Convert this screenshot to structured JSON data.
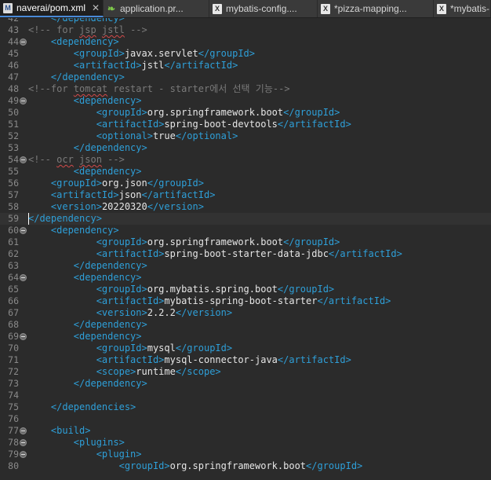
{
  "tabs": [
    {
      "label": "naverai/pom.xml",
      "icon": "maven-m-icon",
      "icon_glyph": "M",
      "active": true,
      "close": "✕"
    },
    {
      "label": "application.pr...",
      "icon": "spring-leaf-icon",
      "icon_glyph": "❧",
      "active": false
    },
    {
      "label": "mybatis-config....",
      "icon": "xml-file-icon",
      "icon_glyph": "X",
      "active": false
    },
    {
      "label": "*pizza-mapping...",
      "icon": "xml-file-icon",
      "icon_glyph": "X",
      "active": false
    },
    {
      "label": "*mybatis-",
      "icon": "xml-file-icon",
      "icon_glyph": "X",
      "active": false
    }
  ],
  "lines": [
    {
      "n": "42",
      "parts": [
        [
          "    ",
          "tx"
        ],
        [
          "</dependency>",
          "tg"
        ]
      ]
    },
    {
      "n": "43",
      "parts": [
        [
          "<!-- for ",
          "cm"
        ],
        [
          "jsp",
          "cm sq"
        ],
        [
          " ",
          "cm"
        ],
        [
          "jstl",
          "cm sq"
        ],
        [
          " -->",
          "cm"
        ]
      ]
    },
    {
      "n": "44",
      "fold": true,
      "parts": [
        [
          "    ",
          "tx"
        ],
        [
          "<dependency>",
          "tg"
        ]
      ]
    },
    {
      "n": "45",
      "parts": [
        [
          "        ",
          "tx"
        ],
        [
          "<groupId>",
          "tg"
        ],
        [
          "javax.servlet",
          "tx"
        ],
        [
          "</groupId>",
          "tg"
        ]
      ]
    },
    {
      "n": "46",
      "parts": [
        [
          "        ",
          "tx"
        ],
        [
          "<artifactId>",
          "tg"
        ],
        [
          "jstl",
          "tx"
        ],
        [
          "</artifactId>",
          "tg"
        ]
      ]
    },
    {
      "n": "47",
      "parts": [
        [
          "    ",
          "tx"
        ],
        [
          "</dependency>",
          "tg"
        ]
      ]
    },
    {
      "n": "48",
      "parts": [
        [
          "<!--for ",
          "cm"
        ],
        [
          "tomcat",
          "cm sq"
        ],
        [
          " restart - starter에서 선택 기능-->",
          "cm"
        ]
      ]
    },
    {
      "n": "49",
      "fold": true,
      "parts": [
        [
          "        ",
          "tx"
        ],
        [
          "<dependency>",
          "tg"
        ]
      ]
    },
    {
      "n": "50",
      "parts": [
        [
          "            ",
          "tx"
        ],
        [
          "<groupId>",
          "tg"
        ],
        [
          "org.springframework.boot",
          "tx"
        ],
        [
          "</groupId>",
          "tg"
        ]
      ]
    },
    {
      "n": "51",
      "parts": [
        [
          "            ",
          "tx"
        ],
        [
          "<artifactId>",
          "tg"
        ],
        [
          "spring-boot-devtools",
          "tx"
        ],
        [
          "</artifactId>",
          "tg"
        ]
      ]
    },
    {
      "n": "52",
      "parts": [
        [
          "            ",
          "tx"
        ],
        [
          "<optional>",
          "tg"
        ],
        [
          "true",
          "tx"
        ],
        [
          "</optional>",
          "tg"
        ]
      ]
    },
    {
      "n": "53",
      "parts": [
        [
          "        ",
          "tx"
        ],
        [
          "</dependency>",
          "tg"
        ]
      ]
    },
    {
      "n": "54",
      "fold": true,
      "parts": [
        [
          "<!-- ",
          "cm"
        ],
        [
          "ocr",
          "cm sq"
        ],
        [
          " ",
          "cm"
        ],
        [
          "json",
          "cm sq"
        ],
        [
          " -->",
          "cm"
        ]
      ]
    },
    {
      "n": "55",
      "parts": [
        [
          "        ",
          "tx"
        ],
        [
          "<dependency>",
          "tg"
        ]
      ]
    },
    {
      "n": "56",
      "parts": [
        [
          "    ",
          "tx"
        ],
        [
          "<groupId>",
          "tg"
        ],
        [
          "org.json",
          "tx"
        ],
        [
          "</groupId>",
          "tg"
        ]
      ]
    },
    {
      "n": "57",
      "parts": [
        [
          "    ",
          "tx"
        ],
        [
          "<artifactId>",
          "tg"
        ],
        [
          "json",
          "tx"
        ],
        [
          "</artifactId>",
          "tg"
        ]
      ]
    },
    {
      "n": "58",
      "parts": [
        [
          "    ",
          "tx"
        ],
        [
          "<version>",
          "tg"
        ],
        [
          "20220320",
          "tx"
        ],
        [
          "</version>",
          "tg"
        ]
      ]
    },
    {
      "n": "59",
      "current": true,
      "caret": true,
      "parts": [
        [
          "</dependency>",
          "tg"
        ]
      ]
    },
    {
      "n": "60",
      "fold": true,
      "parts": [
        [
          "    ",
          "tx"
        ],
        [
          "<dependency>",
          "tg"
        ]
      ]
    },
    {
      "n": "61",
      "parts": [
        [
          "            ",
          "tx"
        ],
        [
          "<groupId>",
          "tg"
        ],
        [
          "org.springframework.boot",
          "tx"
        ],
        [
          "</groupId>",
          "tg"
        ]
      ]
    },
    {
      "n": "62",
      "parts": [
        [
          "            ",
          "tx"
        ],
        [
          "<artifactId>",
          "tg"
        ],
        [
          "spring-boot-starter-data-jdbc",
          "tx"
        ],
        [
          "</artifactId>",
          "tg"
        ]
      ]
    },
    {
      "n": "63",
      "parts": [
        [
          "        ",
          "tx"
        ],
        [
          "</dependency>",
          "tg"
        ]
      ]
    },
    {
      "n": "64",
      "fold": true,
      "parts": [
        [
          "        ",
          "tx"
        ],
        [
          "<dependency>",
          "tg"
        ]
      ]
    },
    {
      "n": "65",
      "parts": [
        [
          "            ",
          "tx"
        ],
        [
          "<groupId>",
          "tg"
        ],
        [
          "org.mybatis.spring.boot",
          "tx"
        ],
        [
          "</groupId>",
          "tg"
        ]
      ]
    },
    {
      "n": "66",
      "parts": [
        [
          "            ",
          "tx"
        ],
        [
          "<artifactId>",
          "tg"
        ],
        [
          "mybatis-spring-boot-starter",
          "tx"
        ],
        [
          "</artifactId>",
          "tg"
        ]
      ]
    },
    {
      "n": "67",
      "parts": [
        [
          "            ",
          "tx"
        ],
        [
          "<version>",
          "tg"
        ],
        [
          "2.2.2",
          "tx"
        ],
        [
          "</version>",
          "tg"
        ]
      ]
    },
    {
      "n": "68",
      "parts": [
        [
          "        ",
          "tx"
        ],
        [
          "</dependency>",
          "tg"
        ]
      ]
    },
    {
      "n": "69",
      "fold": true,
      "parts": [
        [
          "        ",
          "tx"
        ],
        [
          "<dependency>",
          "tg"
        ]
      ]
    },
    {
      "n": "70",
      "parts": [
        [
          "            ",
          "tx"
        ],
        [
          "<groupId>",
          "tg"
        ],
        [
          "mysql",
          "tx"
        ],
        [
          "</groupId>",
          "tg"
        ]
      ]
    },
    {
      "n": "71",
      "parts": [
        [
          "            ",
          "tx"
        ],
        [
          "<artifactId>",
          "tg"
        ],
        [
          "mysql-connector-java",
          "tx"
        ],
        [
          "</artifactId>",
          "tg"
        ]
      ]
    },
    {
      "n": "72",
      "parts": [
        [
          "            ",
          "tx"
        ],
        [
          "<scope>",
          "tg"
        ],
        [
          "runtime",
          "tx"
        ],
        [
          "</scope>",
          "tg"
        ]
      ]
    },
    {
      "n": "73",
      "parts": [
        [
          "        ",
          "tx"
        ],
        [
          "</dependency>",
          "tg"
        ]
      ]
    },
    {
      "n": "74",
      "parts": []
    },
    {
      "n": "75",
      "parts": [
        [
          "    ",
          "tx"
        ],
        [
          "</dependencies>",
          "tg"
        ]
      ]
    },
    {
      "n": "76",
      "parts": []
    },
    {
      "n": "77",
      "fold": true,
      "parts": [
        [
          "    ",
          "tx"
        ],
        [
          "<build>",
          "tg"
        ]
      ]
    },
    {
      "n": "78",
      "fold": true,
      "parts": [
        [
          "        ",
          "tx"
        ],
        [
          "<plugins>",
          "tg"
        ]
      ]
    },
    {
      "n": "79",
      "fold": true,
      "parts": [
        [
          "            ",
          "tx"
        ],
        [
          "<plugin>",
          "tg"
        ]
      ]
    },
    {
      "n": "80",
      "parts": [
        [
          "                ",
          "tx"
        ],
        [
          "<groupId>",
          "tg"
        ],
        [
          "org.springframework.boot",
          "tx"
        ],
        [
          "</groupId>",
          "tg"
        ]
      ]
    }
  ]
}
